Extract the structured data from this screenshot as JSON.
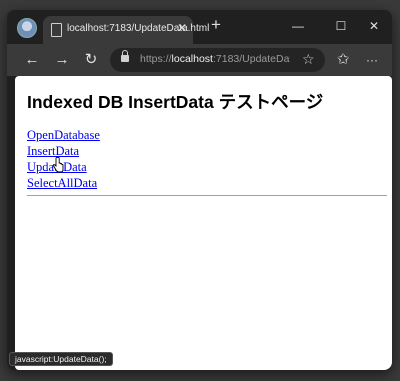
{
  "browser": {
    "tab": {
      "title": "localhost:7183/UpdateData.html",
      "close_glyph": "✕"
    },
    "new_tab_glyph": "+",
    "window_controls": {
      "minimize": "—",
      "maximize": "☐",
      "close": "✕"
    },
    "toolbar": {
      "back_glyph": "←",
      "forward_glyph": "→",
      "reload_glyph": "↻",
      "favorites_glyph": "☆",
      "collections_glyph": "✩",
      "more_glyph": "···"
    },
    "address_bar": {
      "scheme": "https://",
      "host": "localhost",
      "rest": ":7183/UpdateDat...",
      "star_glyph": "☆"
    }
  },
  "page": {
    "heading": "Indexed DB InsertData テストページ",
    "links": [
      {
        "label": "OpenDatabase"
      },
      {
        "label": "InsertData"
      },
      {
        "label": "UpdateData"
      },
      {
        "label": "SelectAllData"
      }
    ]
  },
  "status_bar": {
    "text": "javascript:UpdateData();"
  },
  "icons": {
    "profile": "profile-avatar-icon",
    "tab_page": "page-icon",
    "lock": "lock-icon",
    "star": "star-icon",
    "cursor": "hand-pointer-icon"
  }
}
